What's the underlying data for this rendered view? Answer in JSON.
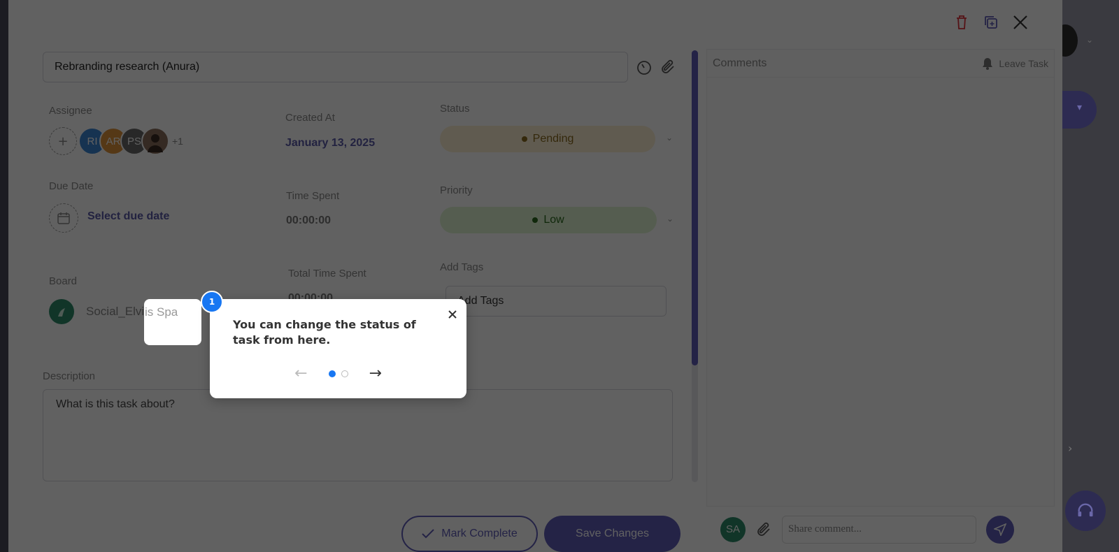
{
  "task": {
    "title": "Rebranding research (Anura)",
    "assignee_label": "Assignee",
    "assignees": [
      {
        "initials": "RI",
        "color": "#3b86d6"
      },
      {
        "initials": "AR",
        "color": "#e0943a"
      },
      {
        "initials": "PS",
        "color": "#6b6b6b"
      }
    ],
    "assignees_more": "+1",
    "created_label": "Created At",
    "created_value": "January 13, 2025",
    "status_label": "Status",
    "status_value": "Pending",
    "status_color": "#8a6a1e",
    "due_label": "Due Date",
    "due_value": "Select due date",
    "time_spent_label": "Time Spent",
    "time_spent_value": "00:00:00",
    "priority_label": "Priority",
    "priority_value": "Low",
    "priority_color": "#2a6a1e",
    "board_label": "Board",
    "board_value": "Social_Elvis Spa",
    "total_time_label": "Total Time Spent",
    "total_time_value": "00:00:00",
    "tags_label": "Add Tags",
    "tags_placeholder": "Add Tags",
    "description_label": "Description",
    "description_placeholder": "What is this task about?",
    "mark_complete_label": "Mark Complete",
    "save_label": "Save Changes"
  },
  "comments": {
    "title": "Comments",
    "leave_task": "Leave Task",
    "me_initials": "SA",
    "input_placeholder": "Share comment..."
  },
  "tour": {
    "step": "1",
    "message": "You can change the status of task from here.",
    "spotlight_text": "is Spa",
    "total_steps": 2,
    "current_step": 1
  },
  "colors": {
    "accent": "#5f5cb8",
    "tour_blue": "#1877f2",
    "delete_red": "#e0313b"
  }
}
